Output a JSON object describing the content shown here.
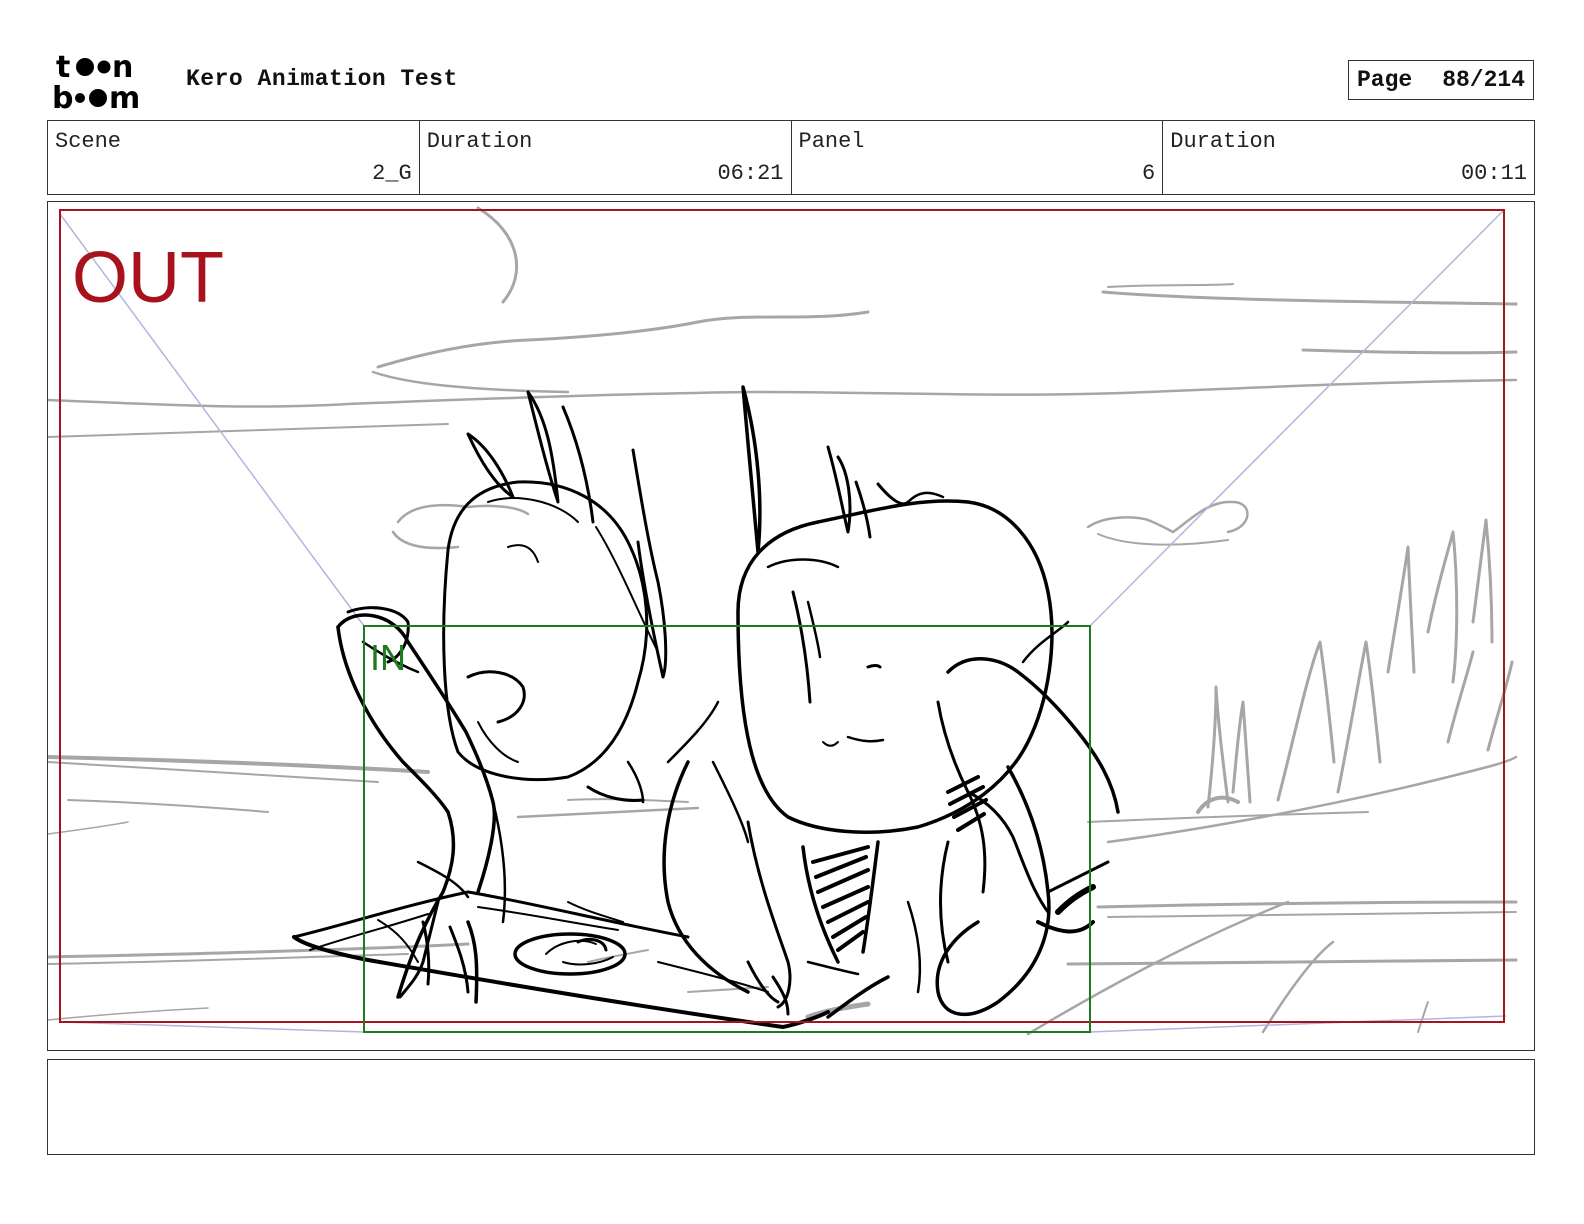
{
  "header": {
    "logo_top": "toon",
    "logo_bottom": "boom",
    "project_title": "Kero Animation Test",
    "page_label": "Page",
    "page_number": "88/214"
  },
  "info": {
    "scene_label": "Scene",
    "scene_value": "2_G",
    "scene_duration_label": "Duration",
    "scene_duration_value": "06:21",
    "panel_label": "Panel",
    "panel_value": "6",
    "panel_duration_label": "Duration",
    "panel_duration_value": "00:11"
  },
  "panel": {
    "out_label": "OUT",
    "in_label": "IN",
    "colors": {
      "out_frame": "#a8121c",
      "in_frame": "#1e7a1e",
      "camera_guides": "#b4b4e0",
      "background_sketch": "#a6a6a6",
      "character_sketch": "#000000"
    }
  },
  "notes": {
    "text": ""
  }
}
